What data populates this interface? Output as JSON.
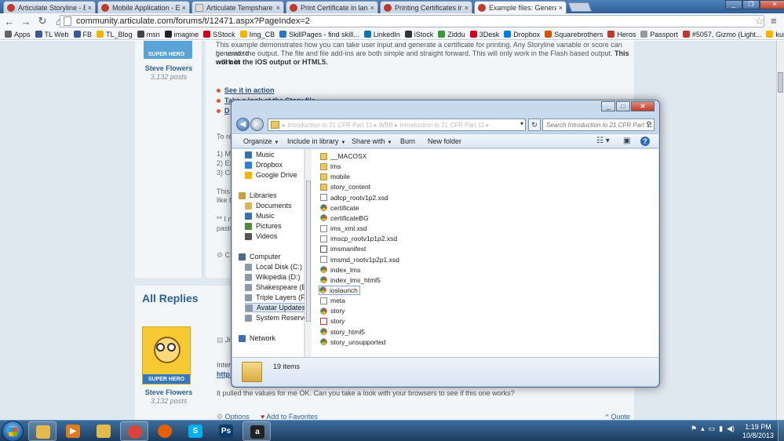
{
  "browser": {
    "tabs": [
      {
        "label": "Articulate Storyline - E-Le",
        "icon_color": "#c0392b"
      },
      {
        "label": "Mobile Application - E-Le",
        "icon_color": "#c0392b"
      },
      {
        "label": "Articulate Tempshare",
        "icon_color": "#999999"
      },
      {
        "label": "Print Certificate in landsc",
        "icon_color": "#c0392b"
      },
      {
        "label": "Printing Certificates in St",
        "icon_color": "#c0392b"
      },
      {
        "label": "Example files: Generating",
        "icon_color": "#c0392b"
      }
    ],
    "tab_close": "×",
    "url": "community.articulate.com/forums/t/12471.aspx?PageIndex=2",
    "bookmarks": [
      {
        "label": "Apps",
        "color": "#666666"
      },
      {
        "label": "TL Web",
        "color": "#3b5998"
      },
      {
        "label": "FB",
        "color": "#3b5998"
      },
      {
        "label": "TL_Blog",
        "color": "#f4b400"
      },
      {
        "label": "msn",
        "color": "#444444"
      },
      {
        "label": "imagine",
        "color": "#222222"
      },
      {
        "label": "SStock",
        "color": "#d0021b"
      },
      {
        "label": "Img_CB",
        "color": "#f4b400"
      },
      {
        "label": "SkillPages - find skill...",
        "color": "#2b78c5"
      },
      {
        "label": "LinkedIn",
        "color": "#0e76a8"
      },
      {
        "label": "iStock",
        "color": "#333333"
      },
      {
        "label": "Ziddu",
        "color": "#3a9a3a"
      },
      {
        "label": "3Desk",
        "color": "#d0021b"
      },
      {
        "label": "Dropbox",
        "color": "#007ee5"
      },
      {
        "label": "Squarebrothers",
        "color": "#d35400"
      },
      {
        "label": "Heros",
        "color": "#c0392b"
      },
      {
        "label": "Passport",
        "color": "#999999"
      },
      {
        "label": "#5057, Gizmo (Light...",
        "color": "#c0392b"
      },
      {
        "label": "kumbal",
        "color": "#f4b400"
      }
    ]
  },
  "page": {
    "top_post": {
      "badge": "SUPER HERO",
      "author": "Steve Flowers",
      "posts": "3,132 posts",
      "intro_line1": "This example demonstrates how you can take user input and generate a certificate for printing. Any Storyline variable or score can be used to",
      "intro_line2": "generate the output. The file and file add-ins are both simple and straight forward. This will only work in the Flash based output.",
      "intro_bold": "This will not",
      "intro_line3": "work in the iOS output or HTML5.",
      "links": [
        "See it in action",
        "Take a look at the Story file",
        "D"
      ],
      "fragments": [
        "To re",
        "1) M",
        "2) Ex",
        "3) Co",
        "This",
        "like t",
        "** I m",
        "paste"
      ],
      "footer_fragment": "C"
    },
    "all_replies": "All Replies",
    "reply": {
      "badge": "SUPER HERO",
      "author": "Steve Flowers",
      "posts": "3,132 posts",
      "line1": "Intere",
      "line2": "http:",
      "line3": "It pulled the values for me OK. Can you take a look with your browsers to see if this one works?",
      "options": "Options",
      "add_fav": "Add to Favorites",
      "quote": "Quote",
      "side_fragment": "Ji"
    }
  },
  "explorer": {
    "path_text": "▸ Introduction to 21 CFR Part 11 ▸ WBB ▸ Introduction to 21 CFR Part 11 ▸",
    "search_placeholder": "Search Introduction to 21 CFR Part 11",
    "toolbar": {
      "organize": "Organize",
      "include": "Include in library",
      "share": "Share with",
      "burn": "Burn",
      "new_folder": "New folder"
    },
    "nav": [
      {
        "label": "Music",
        "color": "#3a6fb5",
        "indent": 1
      },
      {
        "label": "Dropbox",
        "color": "#2d7fd6",
        "indent": 1
      },
      {
        "label": "Google Drive",
        "color": "#f4b400",
        "indent": 1
      },
      {
        "label": "Libraries",
        "color": "#c9a03a",
        "indent": 0
      },
      {
        "label": "Documents",
        "color": "#d9b458",
        "indent": 1
      },
      {
        "label": "Music",
        "color": "#3a6fb5",
        "indent": 1
      },
      {
        "label": "Pictures",
        "color": "#4a8c3c",
        "indent": 1
      },
      {
        "label": "Videos",
        "color": "#555555",
        "indent": 1
      },
      {
        "label": "Computer",
        "color": "#4a6a8c",
        "indent": 0
      },
      {
        "label": "Local Disk (C:)",
        "color": "#8a9aaa",
        "indent": 1
      },
      {
        "label": "Wikipedia (D:)",
        "color": "#8a9aaa",
        "indent": 1
      },
      {
        "label": "Shakespeare (E:)",
        "color": "#8a9aaa",
        "indent": 1
      },
      {
        "label": "Triple Layers (F:)",
        "color": "#8a9aaa",
        "indent": 1
      },
      {
        "label": "Avatar Updates (",
        "color": "#8a9aaa",
        "indent": 1,
        "highlight": true
      },
      {
        "label": "System Reserved",
        "color": "#8a9aaa",
        "indent": 1
      },
      {
        "label": "Network",
        "color": "#3a6fb5",
        "indent": 0
      }
    ],
    "files": [
      {
        "name": "__MACOSX",
        "type": "folder"
      },
      {
        "name": "lms",
        "type": "folder"
      },
      {
        "name": "mobile",
        "type": "folder"
      },
      {
        "name": "story_content",
        "type": "folder"
      },
      {
        "name": "adlcp_rootv1p2.xsd",
        "type": "xsd"
      },
      {
        "name": "certificate",
        "type": "chrome"
      },
      {
        "name": "certificateBG",
        "type": "chrome"
      },
      {
        "name": "ims_xml.xsd",
        "type": "xsd"
      },
      {
        "name": "imscp_rootv1p1p2.xsd",
        "type": "xsd"
      },
      {
        "name": "imsmanifest",
        "type": "pdf"
      },
      {
        "name": "imsmd_rootv1p2p1.xsd",
        "type": "xsd"
      },
      {
        "name": "index_lms",
        "type": "chrome"
      },
      {
        "name": "index_lms_html5",
        "type": "chrome"
      },
      {
        "name": "ioslaunch",
        "type": "chrome",
        "selected": true
      },
      {
        "name": "meta",
        "type": "xsd"
      },
      {
        "name": "story",
        "type": "chrome"
      },
      {
        "name": "story",
        "type": "swf"
      },
      {
        "name": "story_html5",
        "type": "chrome"
      },
      {
        "name": "story_unsupported",
        "type": "chrome"
      }
    ],
    "status_count": "19 items"
  },
  "taskbar": {
    "apps": [
      {
        "name": "windows-explorer",
        "color": "#e3b94b",
        "glyph": "",
        "active": true
      },
      {
        "name": "media-player",
        "color": "#e07a1f",
        "glyph": "▶",
        "active": false
      },
      {
        "name": "file-explorer",
        "color": "#e3b94b",
        "glyph": "",
        "active": false
      },
      {
        "name": "chrome",
        "color": "#db4437",
        "glyph": "",
        "active": true
      },
      {
        "name": "firefox",
        "color": "#e66000",
        "glyph": "",
        "active": false
      },
      {
        "name": "skype",
        "color": "#00aff0",
        "glyph": "S",
        "active": false
      },
      {
        "name": "photoshop",
        "color": "#0a3d6b",
        "glyph": "Ps",
        "active": false
      },
      {
        "name": "articulate",
        "color": "#222222",
        "glyph": "a",
        "active": true
      }
    ],
    "time": "1:19 PM",
    "date": "10/8/2013"
  }
}
